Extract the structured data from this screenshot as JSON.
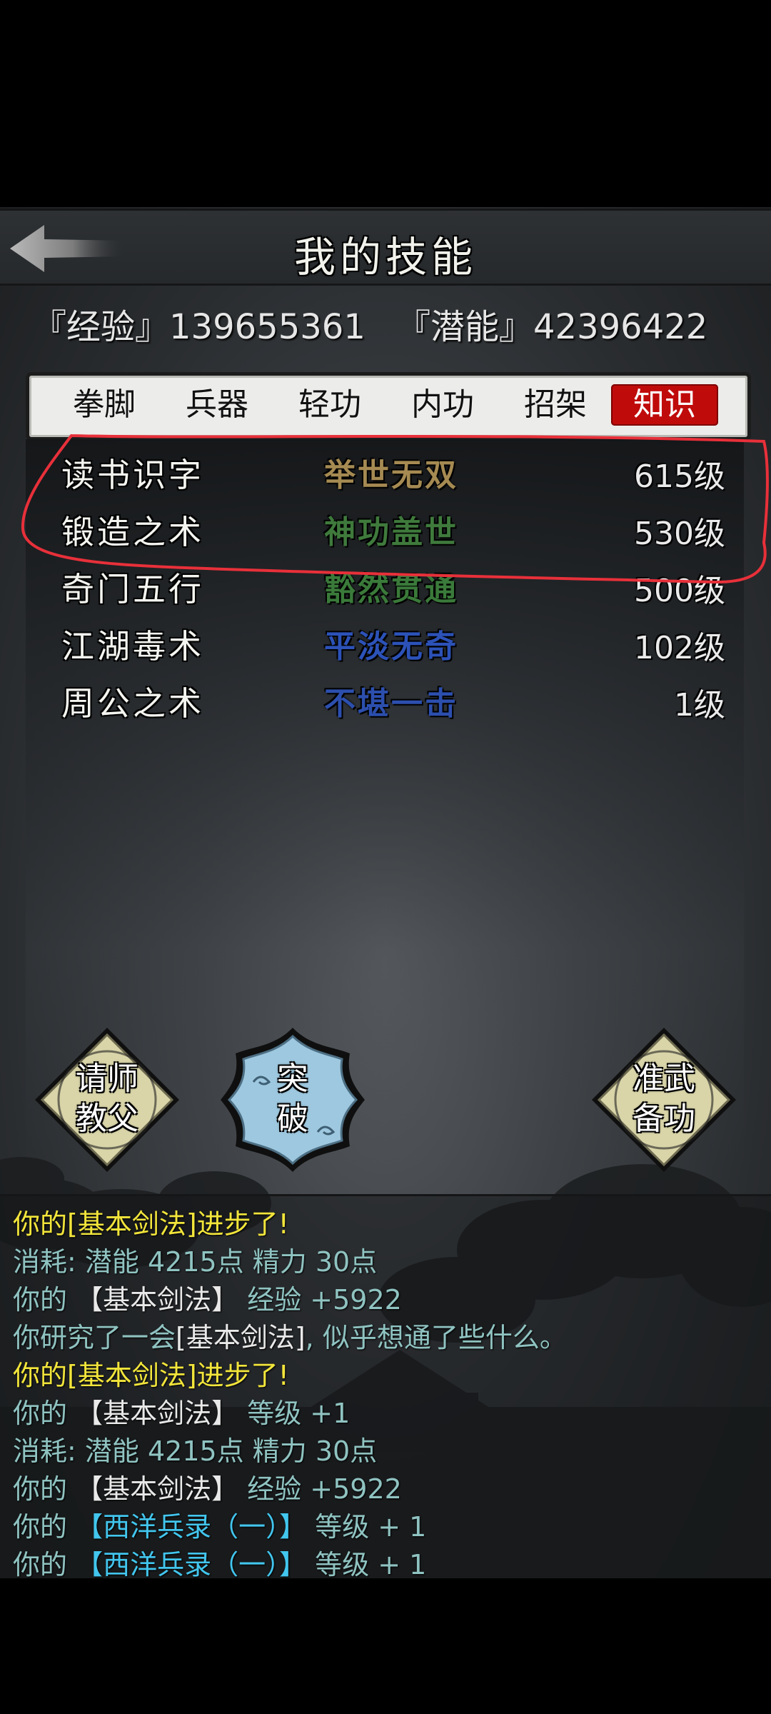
{
  "header": {
    "title": "我的技能",
    "back_icon": "back-arrow-icon"
  },
  "stats": {
    "exp_label": "『经验』139655361",
    "pot_label": "『潜能』42396422"
  },
  "tabs": [
    {
      "label": "拳脚",
      "active": false
    },
    {
      "label": "兵器",
      "active": false
    },
    {
      "label": "轻功",
      "active": false
    },
    {
      "label": "内功",
      "active": false
    },
    {
      "label": "招架",
      "active": false
    },
    {
      "label": "知识",
      "active": true
    }
  ],
  "skills": [
    {
      "name": "读书识字",
      "grade": "举世无双",
      "grade_color": "#a58a52",
      "level": "615级"
    },
    {
      "name": "锻造之术",
      "grade": "神功盖世",
      "grade_color": "#3f7a3c",
      "level": "530级"
    },
    {
      "name": "奇门五行",
      "grade": "豁然贯通",
      "grade_color": "#3a7a3a",
      "level": "500级"
    },
    {
      "name": "江湖毒术",
      "grade": "平淡无奇",
      "grade_color": "#2c52b8",
      "level": "102级"
    },
    {
      "name": "周公之术",
      "grade": "不堪一击",
      "grade_color": "#2c4fae",
      "level": "1级"
    }
  ],
  "buttons": {
    "teacher": "请师\n教父",
    "teacher_lines": [
      "请师",
      "教父"
    ],
    "breakthrough_lines": [
      "突",
      "破"
    ],
    "prepare_lines": [
      "准武",
      "备功"
    ]
  },
  "log": [
    {
      "segments": [
        {
          "t": "你的[基本剑法]进步了!",
          "c": "yellow"
        }
      ]
    },
    {
      "segments": [
        {
          "t": "消耗: 潜能 4215点  精力 30点",
          "c": "teal"
        }
      ]
    },
    {
      "segments": [
        {
          "t": "你的 ",
          "c": "teal"
        },
        {
          "t": "【基本剑法】",
          "c": "white"
        },
        {
          "t": " 经验 +5922",
          "c": "teal"
        }
      ]
    },
    {
      "segments": [
        {
          "t": "你研究了一会",
          "c": "teal"
        },
        {
          "t": "[基本剑法]",
          "c": "white"
        },
        {
          "t": ", 似乎想通了些什么。",
          "c": "teal"
        }
      ]
    },
    {
      "segments": [
        {
          "t": "你的[基本剑法]进步了!",
          "c": "yellow"
        }
      ]
    },
    {
      "segments": [
        {
          "t": "你的 ",
          "c": "teal"
        },
        {
          "t": "【基本剑法】",
          "c": "white"
        },
        {
          "t": " 等级 +1",
          "c": "teal"
        }
      ]
    },
    {
      "segments": [
        {
          "t": "消耗: 潜能 4215点  精力 30点",
          "c": "teal"
        }
      ]
    },
    {
      "segments": [
        {
          "t": "你的 ",
          "c": "teal"
        },
        {
          "t": "【基本剑法】",
          "c": "white"
        },
        {
          "t": " 经验 +5922",
          "c": "teal"
        }
      ]
    },
    {
      "segments": [
        {
          "t": "你的 ",
          "c": "teal"
        },
        {
          "t": "【西洋兵录（一）】",
          "c": "blue"
        },
        {
          "t": " 等级 + 1",
          "c": "teal"
        }
      ]
    },
    {
      "segments": [
        {
          "t": "你的 ",
          "c": "teal"
        },
        {
          "t": "【西洋兵录（一）】",
          "c": "blue"
        },
        {
          "t": " 等级 + 1",
          "c": "teal"
        }
      ]
    }
  ]
}
